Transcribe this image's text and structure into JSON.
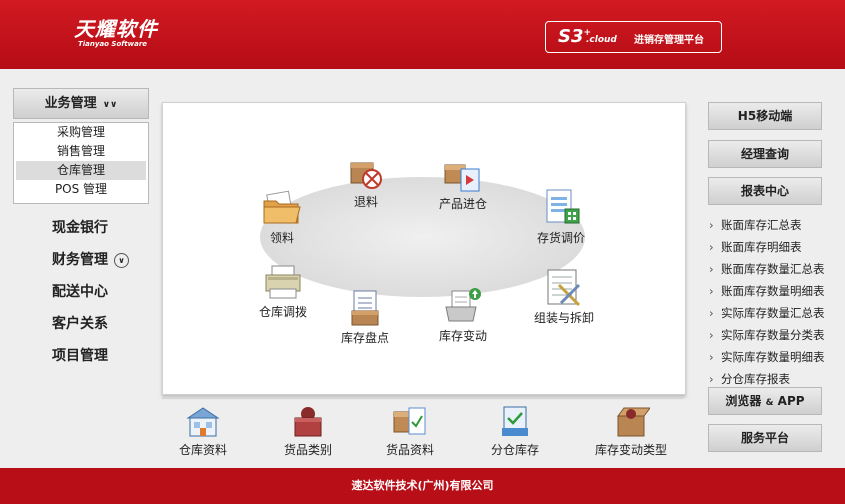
{
  "header": {
    "logo_cn": "天耀软件",
    "logo_en": "Tianyao Software",
    "product_s3": "S3",
    "product_plus": "+",
    "product_cloud": ".cloud",
    "platform_name": "进销存管理平台"
  },
  "left": {
    "group_title": "业务管理",
    "submenu": [
      "采购管理",
      "销售管理",
      "仓库管理",
      "POS 管理"
    ],
    "selected_submenu": "仓库管理",
    "nav": [
      "现金银行",
      "财务管理",
      "配送中心",
      "客户关系",
      "项目管理"
    ]
  },
  "main": {
    "nodes": {
      "tuiliao": "退料",
      "chanpin": "产品进仓",
      "lingliao": "领料",
      "cunhuo": "存货调价",
      "cangku": "仓库调拨",
      "zuzhuang": "组装与拆卸",
      "pandian": "库存盘点",
      "biandong": "库存变动"
    }
  },
  "bottom": [
    "仓库资料",
    "货品类别",
    "货品资料",
    "分仓库存",
    "库存变动类型"
  ],
  "right": {
    "h5": "H5移动端",
    "manager": "经理查询",
    "report_center": "报表中心",
    "reports": [
      "账面库存汇总表",
      "账面库存明细表",
      "账面库存数量汇总表",
      "账面库存数量明细表",
      "实际库存数量汇总表",
      "实际库存数量分类表",
      "实际库存数量明细表",
      "分仓库存报表"
    ],
    "browser": "浏览器",
    "browser_amp": "&",
    "browser_app": "APP",
    "service": "服务平台"
  },
  "footer": "速达软件技术(广州)有限公司",
  "colors": {
    "brand_red": "#c4101a",
    "panel_bg": "#eeeeee"
  }
}
